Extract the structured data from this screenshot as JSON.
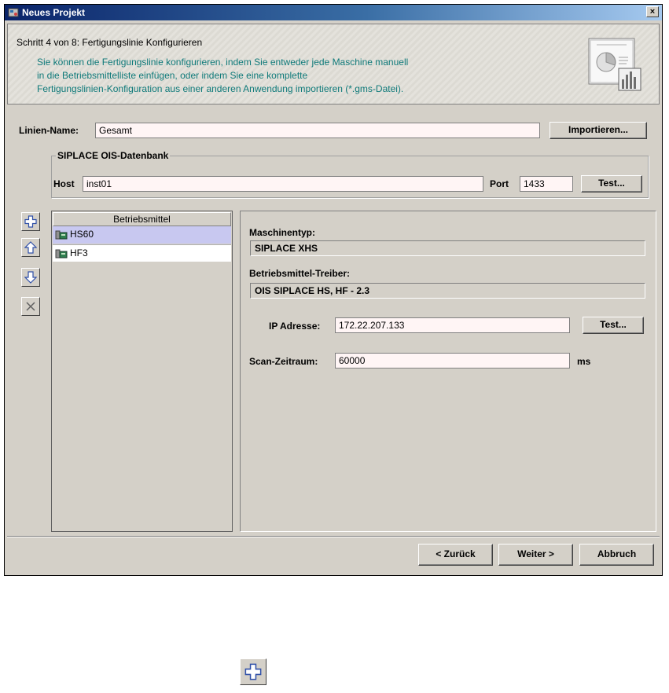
{
  "window": {
    "title": "Neues Projekt",
    "close_glyph": "×"
  },
  "header": {
    "step": "Schritt 4 von 8: Fertigungslinie Konfigurieren",
    "description_lines": [
      "Sie können die Fertigungslinie konfigurieren, indem Sie entweder jede Maschine manuell",
      "in die Betriebsmittelliste einfügen, oder indem Sie eine komplette",
      "Fertigungslinien-Konfiguration aus einer anderen Anwendung importieren (*.gms-Datei)."
    ],
    "description_color": "#0f7a7a"
  },
  "line": {
    "name_label": "Linien-Name:",
    "name_value": "Gesamt",
    "import_label": "Importieren..."
  },
  "database": {
    "group_title": "SIPLACE OIS-Datenbank",
    "host_label": "Host",
    "host_value": "inst01",
    "port_label": "Port",
    "port_value": "1433",
    "test_label": "Test..."
  },
  "toolbar": {
    "icons": [
      "add-icon",
      "move-up-icon",
      "move-down-icon",
      "delete-icon"
    ]
  },
  "equipment_list": {
    "header": "Betriebsmittel",
    "items": [
      {
        "label": "HS60",
        "selected": true
      },
      {
        "label": "HF3",
        "selected": false
      }
    ],
    "selection_color": "#c8c8f0"
  },
  "properties": {
    "machine_type_label": "Maschinentyp:",
    "machine_type_value": "SIPLACE XHS",
    "driver_label": "Betriebsmittel-Treiber:",
    "driver_value": "OIS SIPLACE HS, HF - 2.3",
    "ip_label": "IP Adresse:",
    "ip_value": "172.22.207.133",
    "ip_test_label": "Test...",
    "scan_label": "Scan-Zeitraum:",
    "scan_value": "60000",
    "scan_unit": "ms"
  },
  "footer": {
    "back_label": "< Zurück",
    "next_label": "Weiter >",
    "cancel_label": "Abbruch"
  },
  "magnified_icon": "add-icon"
}
